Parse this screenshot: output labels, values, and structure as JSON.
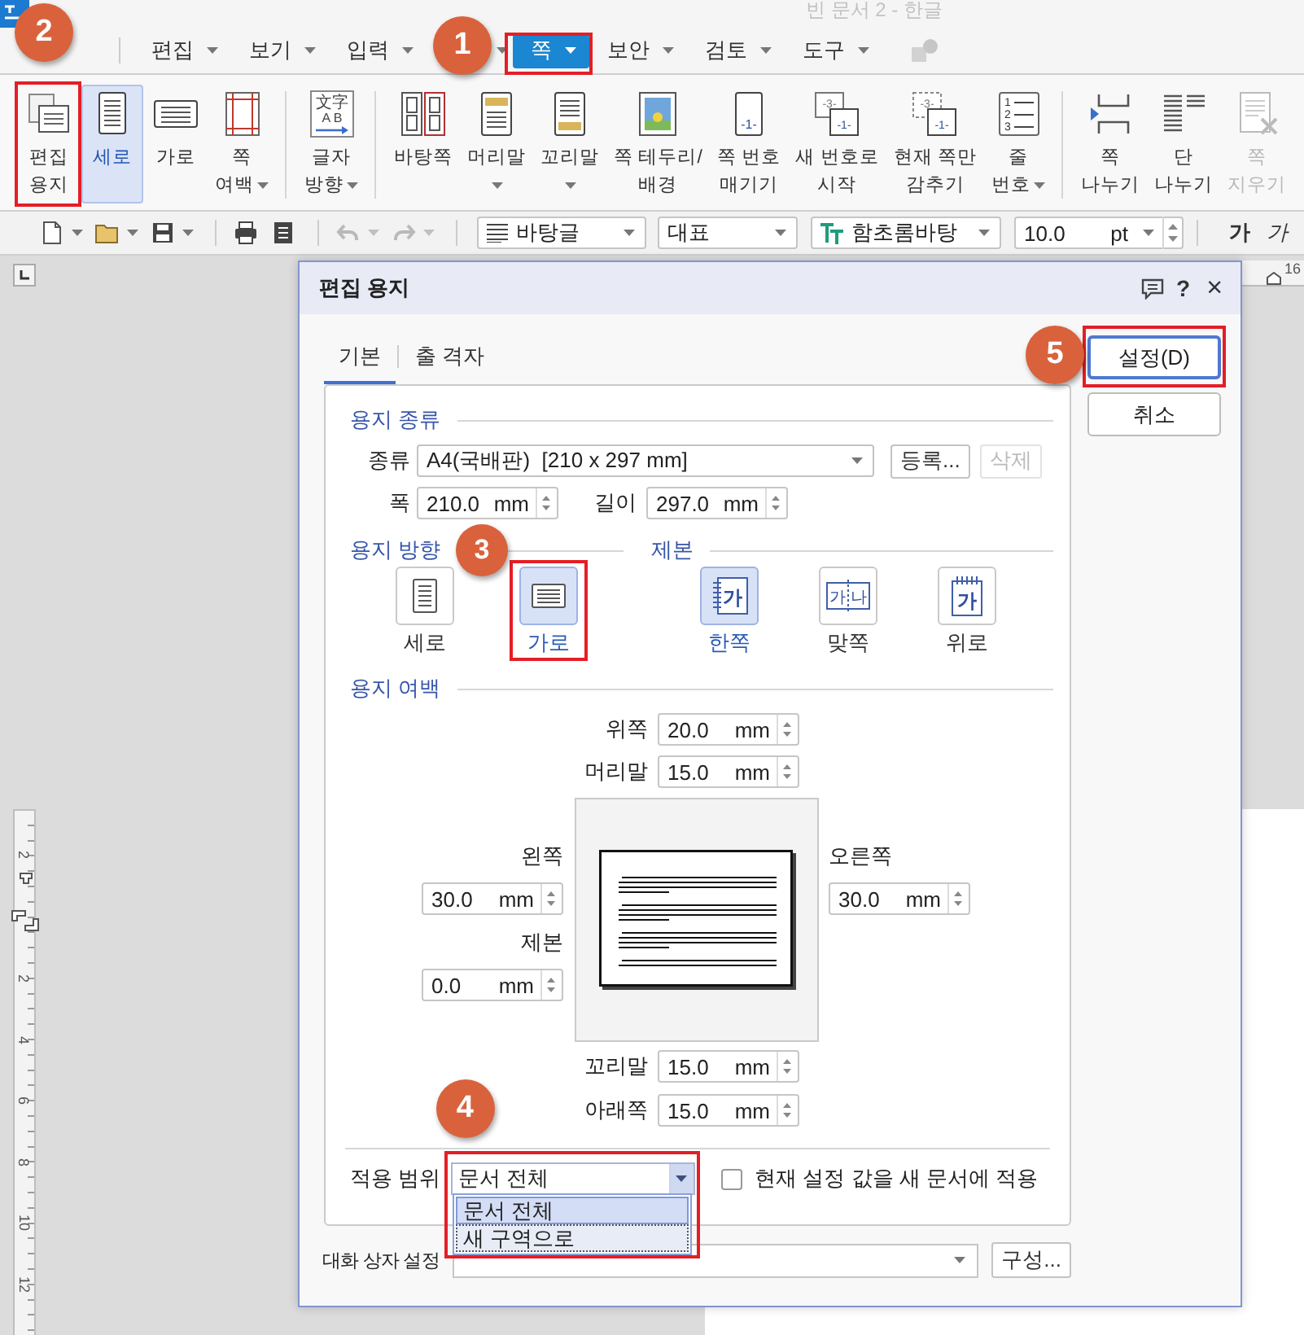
{
  "window": {
    "title": "빈 문서 2 - 한글"
  },
  "menu": [
    {
      "label": "편집",
      "selected": false
    },
    {
      "label": "보기",
      "selected": false
    },
    {
      "label": "입력",
      "selected": false
    },
    {
      "selected": false
    },
    {
      "label": "쪽",
      "selected": true,
      "step": "1"
    },
    {
      "label": "보안",
      "selected": false
    },
    {
      "label": "검토",
      "selected": false
    },
    {
      "label": "도구",
      "selected": false
    }
  ],
  "ribbon": [
    {
      "items": [
        {
          "lines": [
            "편집",
            "용지"
          ],
          "selected": false,
          "disabled": false,
          "dropdown": false,
          "step": "2"
        },
        {
          "lines": [
            "세로"
          ],
          "selected": true,
          "disabled": false,
          "dropdown": false
        },
        {
          "lines": [
            "가로"
          ],
          "selected": false,
          "disabled": false,
          "dropdown": false
        },
        {
          "lines": [
            "쪽",
            "여백"
          ],
          "selected": false,
          "disabled": false,
          "dropdown": true
        }
      ]
    },
    {
      "items": [
        {
          "lines": [
            "글자",
            "방향"
          ],
          "selected": false,
          "disabled": false,
          "dropdown": true,
          "icon_text": [
            "文字",
            "A B"
          ]
        }
      ]
    },
    {
      "items": [
        {
          "lines": [
            "바탕쪽"
          ],
          "selected": false,
          "disabled": false,
          "dropdown": false
        },
        {
          "lines": [
            "머리말"
          ],
          "selected": false,
          "disabled": false,
          "dropdown": true
        },
        {
          "lines": [
            "꼬리말"
          ],
          "selected": false,
          "disabled": false,
          "dropdown": true
        },
        {
          "lines": [
            "쪽 테두리/",
            "배경"
          ],
          "selected": false,
          "disabled": false,
          "dropdown": false
        },
        {
          "lines": [
            "쪽 번호",
            "매기기"
          ],
          "selected": false,
          "disabled": false,
          "dropdown": false,
          "icon_text": [
            "-1-"
          ]
        },
        {
          "lines": [
            "새 번호로",
            "시작"
          ],
          "selected": false,
          "disabled": false,
          "dropdown": false,
          "icon_text": [
            "-3-",
            "-1-"
          ]
        },
        {
          "lines": [
            "현재 쪽만",
            "감추기"
          ],
          "selected": false,
          "disabled": false,
          "dropdown": false,
          "icon_text": [
            "-3-",
            "-1-"
          ]
        },
        {
          "lines": [
            "줄",
            "번호"
          ],
          "selected": false,
          "disabled": false,
          "dropdown": true,
          "icon_text": [
            "1",
            "2",
            "3"
          ]
        }
      ]
    },
    {
      "items": [
        {
          "lines": [
            "쪽",
            "나누기"
          ],
          "selected": false,
          "disabled": false,
          "dropdown": false
        },
        {
          "lines": [
            "단",
            "나누기"
          ],
          "selected": false,
          "disabled": false,
          "dropdown": false
        },
        {
          "lines": [
            "쪽",
            "지우기"
          ],
          "selected": false,
          "disabled": true,
          "dropdown": false
        }
      ]
    }
  ],
  "toolbar": {
    "buttons": [
      {
        "dropdown": true,
        "disabled": false
      },
      {
        "dropdown": true,
        "disabled": false
      },
      {
        "dropdown": true,
        "disabled": false
      },
      {
        "dropdown": false,
        "disabled": false
      },
      {
        "dropdown": false,
        "disabled": false
      },
      {
        "dropdown": true,
        "disabled": true
      },
      {
        "dropdown": true,
        "disabled": true
      }
    ],
    "style": "바탕글",
    "language": "대표",
    "font": "함초롬바탕",
    "size": "10.0",
    "size_unit": "pt",
    "format_buttons": [
      {
        "label": "가",
        "kind": "bold"
      },
      {
        "label": "가",
        "kind": "italic"
      }
    ]
  },
  "workspace": {
    "top_ruler_labels": [
      "16"
    ],
    "side_ruler_labels": [
      "2",
      "2",
      "4",
      "6",
      "8",
      "10",
      "12"
    ]
  },
  "dialog": {
    "title": "편집 용지",
    "help": "?",
    "close": "×",
    "tabs": [
      {
        "label": "기본",
        "selected": true
      },
      {
        "label": "출 격자",
        "selected": false
      }
    ],
    "paper": {
      "heading": "용지 종류",
      "type_label": "종류",
      "type": "A4(국배판)  [210 x 297 mm]",
      "register": "등록...",
      "delete": {
        "label": "삭제",
        "disabled": true
      },
      "width_label": "폭",
      "width": {
        "value": "210.0",
        "unit": "mm"
      },
      "length_label": "길이",
      "length": {
        "value": "297.0",
        "unit": "mm"
      }
    },
    "orientation": {
      "heading": "용지 방향",
      "options": [
        {
          "label": "세로",
          "selected": false
        },
        {
          "label": "가로",
          "selected": true,
          "step": "3"
        }
      ]
    },
    "binding": {
      "heading": "제본",
      "options": [
        {
          "label": "한쪽",
          "selected": true,
          "glyphs": [
            "가"
          ]
        },
        {
          "label": "맞쪽",
          "selected": false,
          "glyphs": [
            "가",
            "나"
          ]
        },
        {
          "label": "위로",
          "selected": false,
          "glyphs": [
            "가"
          ]
        }
      ]
    },
    "margins": {
      "heading": "용지 여백",
      "top": [
        {
          "label": "위쪽",
          "value": "20.0",
          "unit": "mm"
        },
        {
          "label": "머리말",
          "value": "15.0",
          "unit": "mm"
        }
      ],
      "left": [
        {
          "label": "왼쪽",
          "value": "30.0",
          "unit": "mm"
        },
        {
          "label": "제본",
          "value": "0.0",
          "unit": "mm"
        }
      ],
      "right": [
        {
          "label": "오른쪽",
          "value": "30.0",
          "unit": "mm"
        }
      ],
      "bottom": [
        {
          "label": "꼬리말",
          "value": "15.0",
          "unit": "mm"
        },
        {
          "label": "아래쪽",
          "value": "15.0",
          "unit": "mm"
        }
      ]
    },
    "apply": {
      "label": "적용 범위",
      "value": "문서 전체",
      "expanded": true,
      "step": "4",
      "options": [
        {
          "label": "문서 전체",
          "selected": true,
          "focused": false
        },
        {
          "label": "새 구역으로",
          "selected": false,
          "focused": true
        }
      ]
    },
    "new_doc_default": {
      "label": "현재 설정 값을 새 문서에 적용",
      "checked": false
    },
    "dialog_settings": {
      "label": "대화 상자 설정",
      "button": "구성..."
    },
    "buttons": [
      {
        "label": "설정(D)",
        "kind": "default",
        "step": "5"
      },
      {
        "label": "취소",
        "kind": "normal"
      }
    ]
  }
}
